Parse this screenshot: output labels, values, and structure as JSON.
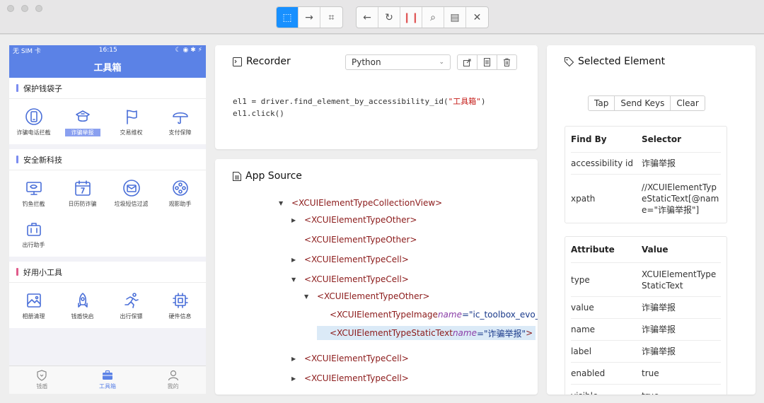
{
  "toolbar": {
    "group1": [
      {
        "name": "select-elements-icon",
        "glyph": "⬚"
      },
      {
        "name": "swipe-icon",
        "glyph": "→"
      },
      {
        "name": "screenshot-icon",
        "glyph": "⌗"
      }
    ],
    "group2": [
      {
        "name": "back-icon",
        "glyph": "←"
      },
      {
        "name": "refresh-icon",
        "glyph": "↻"
      },
      {
        "name": "pause-icon",
        "glyph": "❙❙"
      },
      {
        "name": "search-icon",
        "glyph": "⌕"
      },
      {
        "name": "copy-xml-icon",
        "glyph": "▤"
      },
      {
        "name": "close-icon",
        "glyph": "✕"
      }
    ]
  },
  "phone": {
    "status": {
      "carrier": "无 SIM 卡",
      "time": "16:15",
      "right": "☾ ◉ ✱ ⚡"
    },
    "title": "工具箱",
    "sections": [
      {
        "title": "保护钱袋子",
        "color": "#7b8cf0",
        "items": [
          {
            "label": "诈骗电话拦截",
            "icon": "phone-shield-icon",
            "highlight": false
          },
          {
            "label": "诈骗举报",
            "icon": "police-cap-icon",
            "highlight": true
          },
          {
            "label": "交易维权",
            "icon": "flag-icon",
            "highlight": false
          },
          {
            "label": "支付保障",
            "icon": "umbrella-icon",
            "highlight": false
          }
        ]
      },
      {
        "title": "安全新科技",
        "color": "#7b8cf0",
        "items": [
          {
            "label": "钓鱼拦截",
            "icon": "fish-monitor-icon",
            "highlight": false
          },
          {
            "label": "日历防诈骗",
            "icon": "calendar-icon",
            "highlight": false
          },
          {
            "label": "垃圾短信过滤",
            "icon": "envelope-icon",
            "highlight": false
          },
          {
            "label": "观影助手",
            "icon": "film-reel-icon",
            "highlight": false
          },
          {
            "label": "出行助手",
            "icon": "luggage-icon",
            "highlight": false
          }
        ]
      },
      {
        "title": "好用小工具",
        "color": "#e05a8a",
        "items": [
          {
            "label": "相册清理",
            "icon": "photo-icon",
            "highlight": false
          },
          {
            "label": "钱盾快启",
            "icon": "rocket-icon",
            "highlight": false
          },
          {
            "label": "出行保镖",
            "icon": "runner-icon",
            "highlight": false
          },
          {
            "label": "硬件信息",
            "icon": "chip-icon",
            "highlight": false
          }
        ]
      }
    ],
    "tabs": [
      {
        "label": "钱盾",
        "icon": "shield-tab-icon",
        "active": false
      },
      {
        "label": "工具箱",
        "icon": "toolbox-tab-icon",
        "active": true
      },
      {
        "label": "我的",
        "icon": "person-tab-icon",
        "active": false
      }
    ]
  },
  "recorder": {
    "title": "Recorder",
    "language": "Python",
    "code_line1_prefix": "el1 = driver.find_element_by_accessibility_id(",
    "code_line1_str": "\"工具箱\"",
    "code_line1_suffix": ")",
    "code_line2": "el1.click()"
  },
  "source": {
    "title": "App Source",
    "nodes": [
      {
        "depth": 0,
        "twisty": "▼",
        "tag": "<XCUIElementTypeCollectionView>",
        "attr_name": "",
        "attr_value": "",
        "close": "",
        "selected": false
      },
      {
        "depth": 1,
        "twisty": "▶",
        "tag": "<XCUIElementTypeOther>",
        "attr_name": "",
        "attr_value": "",
        "close": "",
        "selected": false
      },
      {
        "depth": 1,
        "twisty": "",
        "tag": "<XCUIElementTypeOther>",
        "attr_name": "",
        "attr_value": "",
        "close": "",
        "selected": false
      },
      {
        "depth": 1,
        "twisty": "▶",
        "tag": "<XCUIElementTypeCell>",
        "attr_name": "",
        "attr_value": "",
        "close": "",
        "selected": false
      },
      {
        "depth": 1,
        "twisty": "▼",
        "tag": "<XCUIElementTypeCell>",
        "attr_name": "",
        "attr_value": "",
        "close": "",
        "selected": false
      },
      {
        "depth": 2,
        "twisty": "▼",
        "tag": "<XCUIElementTypeOther>",
        "attr_name": "",
        "attr_value": "",
        "close": "",
        "selected": false
      },
      {
        "depth": 3,
        "twisty": "",
        "tag": "<XCUIElementTypeImage ",
        "attr_name": "name",
        "attr_value": "=\"ic_toolbox_evo_",
        "close": "",
        "selected": false
      },
      {
        "depth": 3,
        "twisty": "",
        "tag": "<XCUIElementTypeStaticText ",
        "attr_name": "name",
        "attr_value": "=\"诈骗举报\"",
        "close": ">",
        "selected": true
      },
      {
        "depth": 1,
        "twisty": "▶",
        "tag": "<XCUIElementTypeCell>",
        "attr_name": "",
        "attr_value": "",
        "close": "",
        "selected": false
      },
      {
        "depth": 1,
        "twisty": "▶",
        "tag": "<XCUIElementTypeCell>",
        "attr_name": "",
        "attr_value": "",
        "close": "",
        "selected": false
      }
    ]
  },
  "selected": {
    "title": "Selected Element",
    "actions": [
      "Tap",
      "Send Keys",
      "Clear"
    ],
    "find_by": {
      "headers": [
        "Find By",
        "Selector"
      ],
      "rows": [
        [
          "accessibility id",
          "诈骗举报"
        ],
        [
          "xpath",
          "//XCUIElementTypeStaticText[@name=\"诈骗举报\"]"
        ]
      ]
    },
    "attributes": {
      "headers": [
        "Attribute",
        "Value"
      ],
      "rows": [
        [
          "type",
          "XCUIElementTypeStaticText"
        ],
        [
          "value",
          "诈骗举报"
        ],
        [
          "name",
          "诈骗举报"
        ],
        [
          "label",
          "诈骗举报"
        ],
        [
          "enabled",
          "true"
        ],
        [
          "visible",
          "true"
        ]
      ]
    }
  }
}
